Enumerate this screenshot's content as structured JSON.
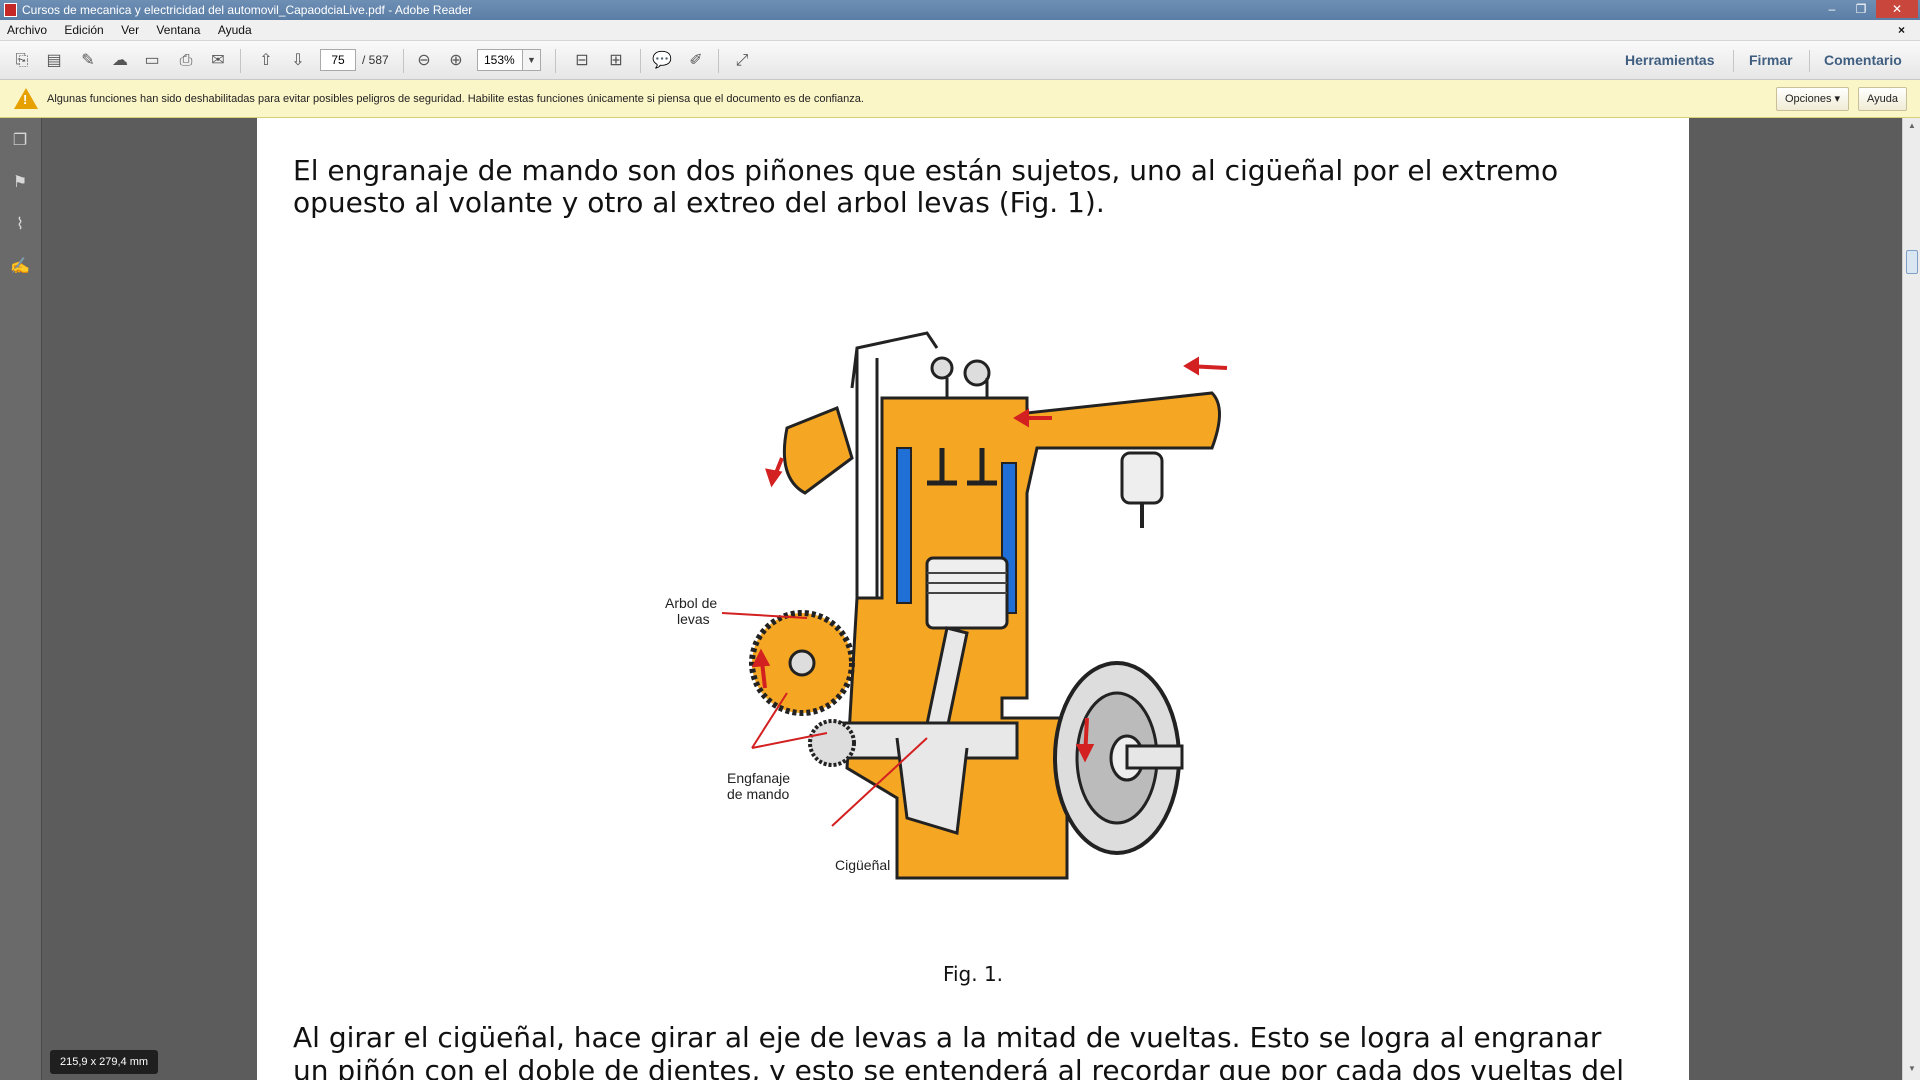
{
  "window": {
    "title": "Cursos de mecanica y electricidad del automovil_CapaodciaLive.pdf - Adobe Reader",
    "min": "–",
    "max": "❐",
    "close": "✕"
  },
  "menu": {
    "items": [
      "Archivo",
      "Edición",
      "Ver",
      "Ventana",
      "Ayuda"
    ],
    "doc_close": "×"
  },
  "toolbar": {
    "page_current": "75",
    "page_total": "/ 587",
    "zoom": "153%",
    "links": [
      "Herramientas",
      "Firmar",
      "Comentario"
    ]
  },
  "security_bar": {
    "message": "Algunas funciones han sido deshabilitadas para evitar posibles peligros de seguridad. Habilite estas funciones únicamente si piensa que el documento es de confianza.",
    "options_label": "Opciones ▾",
    "help_label": "Ayuda"
  },
  "document": {
    "para1_line1": "El engranaje de mando son dos piñones que están sujetos, uno al cigüeñal por el extremo",
    "para1_line2": "opuesto al volante y otro al extreo del arbol levas (Fig. 1).",
    "figure_labels": {
      "arbol_1": "Arbol de",
      "arbol_2": "levas",
      "engranaje_1": "Engfanaje",
      "engranaje_2": "de mando",
      "ciguenal": "Cigüeñal"
    },
    "caption": "Fig. 1.",
    "para2_line1": "Al girar el cigüeñal, hace girar al eje de levas a la mitad de vueltas. Esto se logra al engranar",
    "para2_line2": "un piñón con el doble de dientes, y esto se entenderá al recordar que por cada dos vueltas del"
  },
  "page_size_badge": "215,9 x 279,4 mm",
  "colors": {
    "engine": "#f5a623",
    "water": "#1f6fd6",
    "arrow": "#d32020"
  }
}
